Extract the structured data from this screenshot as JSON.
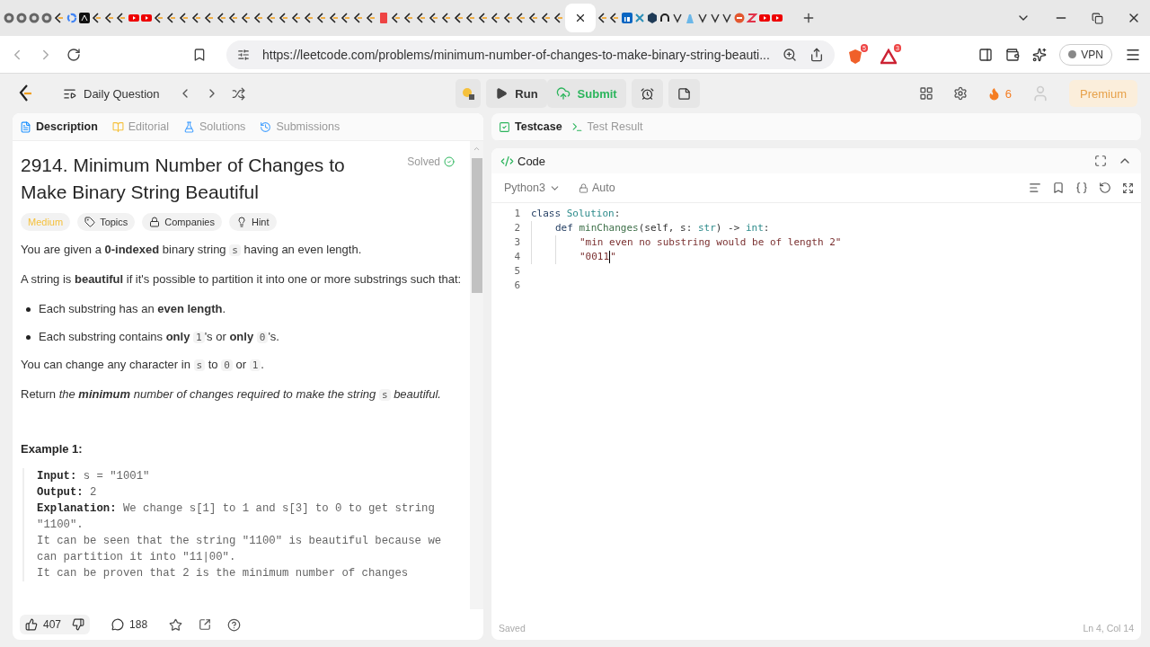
{
  "browser": {
    "tabs": [
      {
        "kind": "grey",
        "selected": false
      },
      {
        "kind": "grey",
        "selected": false
      },
      {
        "kind": "grey",
        "selected": false
      },
      {
        "kind": "grey",
        "selected": false
      },
      {
        "kind": "lc",
        "selected": false
      },
      {
        "kind": "google",
        "selected": false
      },
      {
        "kind": "dark",
        "selected": false
      },
      {
        "kind": "lc",
        "selected": false
      },
      {
        "kind": "lc",
        "selected": false
      },
      {
        "kind": "lc",
        "selected": false
      },
      {
        "kind": "yt",
        "selected": false
      },
      {
        "kind": "yt",
        "selected": false
      },
      {
        "kind": "lc",
        "selected": false
      },
      {
        "kind": "lc",
        "selected": false
      },
      {
        "kind": "lc",
        "selected": false
      },
      {
        "kind": "lc",
        "selected": false
      },
      {
        "kind": "lc",
        "selected": false
      },
      {
        "kind": "lc",
        "selected": false
      },
      {
        "kind": "lc",
        "selected": false
      },
      {
        "kind": "lc",
        "selected": false
      },
      {
        "kind": "lc",
        "selected": false
      },
      {
        "kind": "lc",
        "selected": false
      },
      {
        "kind": "lc",
        "selected": false
      },
      {
        "kind": "lc",
        "selected": false
      },
      {
        "kind": "lc",
        "selected": false
      },
      {
        "kind": "lc",
        "selected": false
      },
      {
        "kind": "lc",
        "selected": false
      },
      {
        "kind": "lc",
        "selected": false
      },
      {
        "kind": "lc",
        "selected": false
      },
      {
        "kind": "lc",
        "selected": false
      },
      {
        "kind": "red",
        "selected": false
      },
      {
        "kind": "lc",
        "selected": false
      },
      {
        "kind": "lc",
        "selected": false
      },
      {
        "kind": "lc",
        "selected": false
      },
      {
        "kind": "lc",
        "selected": false
      },
      {
        "kind": "lc",
        "selected": false
      },
      {
        "kind": "lc",
        "selected": false
      },
      {
        "kind": "lc",
        "selected": false
      },
      {
        "kind": "lc",
        "selected": false
      },
      {
        "kind": "lc",
        "selected": false
      },
      {
        "kind": "lc",
        "selected": false
      },
      {
        "kind": "lc",
        "selected": false
      },
      {
        "kind": "lc",
        "selected": false
      },
      {
        "kind": "lc",
        "selected": false
      },
      {
        "kind": "lc",
        "selected": false
      },
      {
        "selected": true
      },
      {
        "kind": "lc",
        "selected": false
      },
      {
        "kind": "lc",
        "selected": false
      },
      {
        "kind": "in",
        "selected": false
      },
      {
        "kind": "x",
        "selected": false
      },
      {
        "kind": "hex",
        "selected": false
      },
      {
        "kind": "gh",
        "selected": false
      },
      {
        "kind": "v",
        "selected": false
      },
      {
        "kind": "blue",
        "selected": false
      },
      {
        "kind": "v",
        "selected": false
      },
      {
        "kind": "v",
        "selected": false
      },
      {
        "kind": "v",
        "selected": false
      },
      {
        "kind": "face",
        "selected": false
      },
      {
        "kind": "z",
        "selected": false
      },
      {
        "kind": "yt",
        "selected": false
      },
      {
        "kind": "yt",
        "selected": false
      }
    ],
    "url": "https://leetcode.com/problems/minimum-number-of-changes-to-make-binary-string-beauti...",
    "shield_badge": "5",
    "rewards_badge": "3",
    "vpn": "VPN"
  },
  "header": {
    "daily": "Daily Question",
    "run": "Run",
    "submit": "Submit",
    "streak": "6",
    "premium": "Premium"
  },
  "left_tabs": [
    {
      "label": "Description",
      "selected": true
    },
    {
      "label": "Editorial",
      "selected": false
    },
    {
      "label": "Solutions",
      "selected": false
    },
    {
      "label": "Submissions",
      "selected": false
    }
  ],
  "problem": {
    "title": "2914. Minimum Number of Changes to Make Binary String Beautiful",
    "status": "Solved",
    "difficulty": "Medium",
    "tags": [
      "Topics",
      "Companies",
      "Hint"
    ],
    "paragraphs": [
      {
        "kind": "para",
        "parts": [
          {
            "kind": "text",
            "text": "You are given a **0-indexed** binary string "
          },
          {
            "kind": "code",
            "text": "s"
          },
          {
            "kind": "text",
            "text": " having an even length."
          }
        ]
      },
      {
        "kind": "para",
        "parts": [
          {
            "kind": "text",
            "text": "A string is **beautiful** if it's possible to partition it into one or more substrings such that:"
          }
        ]
      },
      {
        "kind": "bullet",
        "parts": [
          {
            "kind": "text",
            "text": "Each substring has an **even length**."
          }
        ]
      },
      {
        "kind": "bullet",
        "parts": [
          {
            "kind": "text",
            "text": "Each substring contains **only** "
          },
          {
            "kind": "code",
            "text": "1"
          },
          {
            "kind": "text",
            "text": "'s or **only** "
          },
          {
            "kind": "code",
            "text": "0"
          },
          {
            "kind": "text",
            "text": "'s."
          }
        ]
      },
      {
        "kind": "para",
        "parts": [
          {
            "kind": "text",
            "text": "You can change any character in "
          },
          {
            "kind": "code",
            "text": "s"
          },
          {
            "kind": "text",
            "text": " to "
          },
          {
            "kind": "code",
            "text": "0"
          },
          {
            "kind": "text",
            "text": " or "
          },
          {
            "kind": "code",
            "text": "1"
          },
          {
            "kind": "text",
            "text": "."
          }
        ]
      },
      {
        "kind": "para",
        "parts": [
          {
            "kind": "text",
            "text": "Return "
          },
          {
            "kind": "italic",
            "text": "the **minimum** number of changes required to make the string "
          },
          {
            "kind": "code",
            "text": "s"
          },
          {
            "kind": "italic",
            "text": " beautiful."
          }
        ]
      }
    ],
    "example_title": "Example 1:",
    "example_lines": [
      {
        "label": "Input:",
        "text": "s = \"1001\""
      },
      {
        "label": "Output:",
        "text": "2"
      },
      {
        "label": "Explanation:",
        "text": "We change s[1] to 1 and s[3] to 0 to get string"
      },
      {
        "text": "\"1100\"."
      },
      {
        "text": "It can be seen that the string \"1100\" is beautiful because we"
      },
      {
        "text": "can partition it into \"11|00\"."
      },
      {
        "text": "It can be proven that 2 is the minimum number of changes"
      }
    ]
  },
  "footer": {
    "likes": "407",
    "comments": "188"
  },
  "right_tabs": [
    {
      "label": "Testcase",
      "selected": true
    },
    {
      "label": "Test Result",
      "selected": false
    }
  ],
  "editor": {
    "title": "Code",
    "language": "Python3",
    "mode": "Auto",
    "lines": [
      {
        "number": "1",
        "tokens": [
          {
            "kind": "kw",
            "text": "class "
          },
          {
            "kind": "cls",
            "text": "Solution"
          },
          {
            "kind": "plain",
            "text": ":"
          }
        ],
        "children": [
          {
            "number": "2",
            "tokens": [
              {
                "kind": "kw",
                "text": "def "
              },
              {
                "kind": "fn",
                "text": "minChanges"
              },
              {
                "kind": "plain",
                "text": "(self, s: "
              },
              {
                "kind": "cls",
                "text": "str"
              },
              {
                "kind": "plain",
                "text": ") -> "
              },
              {
                "kind": "cls",
                "text": "int"
              },
              {
                "kind": "plain",
                "text": ":"
              }
            ],
            "children": [
              {
                "number": "3",
                "tokens": [
                  {
                    "kind": "str",
                    "text": "\"min even no substring would be of length 2\""
                  }
                ]
              },
              {
                "number": "4",
                "cursor": true,
                "tokens": [
                  {
                    "kind": "str",
                    "text": "\"0011"
                  },
                  {
                    "kind": "str",
                    "text": "\""
                  }
                ]
              }
            ]
          }
        ]
      },
      {
        "number": "5"
      },
      {
        "number": "6"
      }
    ],
    "saved": "Saved",
    "position": "Ln 4, Col 14"
  }
}
